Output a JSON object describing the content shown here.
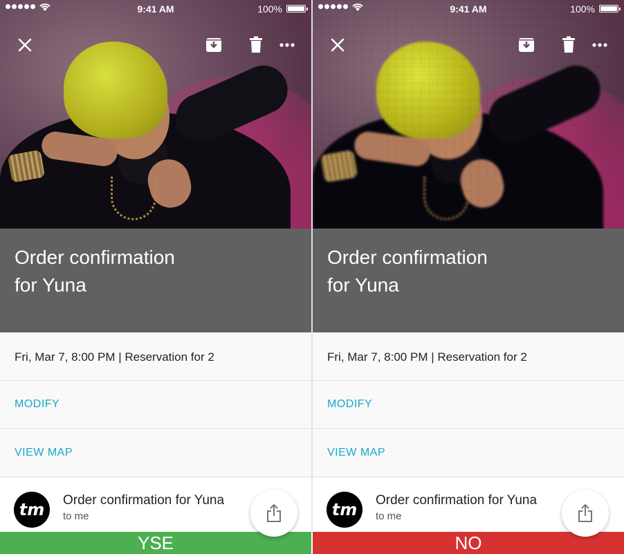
{
  "colors": {
    "accent": "#17a8c8",
    "title_band": "#616161",
    "yes_bar": "#4caf50",
    "no_bar": "#d73232"
  },
  "panels": [
    {
      "status": {
        "time": "9:41 AM",
        "battery": "100%"
      },
      "icons": {
        "close": "close-icon",
        "archive": "archive-icon",
        "delete": "trash-icon",
        "more": "more-icon",
        "share": "share-icon"
      },
      "title_line1": "Order confirmation",
      "title_line2": "for Yuna",
      "info": "Fri, Mar 7, 8:00 PM | Reservation for 2",
      "modify": "MODIFY",
      "view_map": "VIEW MAP",
      "message": {
        "avatar": "tm",
        "subject": "Order confirmation for Yuna",
        "to": "to me"
      },
      "verdict": "YSE",
      "image_state": "original"
    },
    {
      "status": {
        "time": "9:41 AM",
        "battery": "100%"
      },
      "icons": {
        "close": "close-icon",
        "archive": "archive-icon",
        "delete": "trash-icon",
        "more": "more-icon",
        "share": "share-icon"
      },
      "title_line1": "Order confirmation",
      "title_line2": "for Yuna",
      "info": "Fri, Mar 7, 8:00 PM | Reservation for 2",
      "modify": "MODIFY",
      "view_map": "VIEW MAP",
      "message": {
        "avatar": "tm",
        "subject": "Order confirmation for Yuna",
        "to": "to me"
      },
      "verdict": "NO",
      "image_state": "pixelated"
    }
  ]
}
